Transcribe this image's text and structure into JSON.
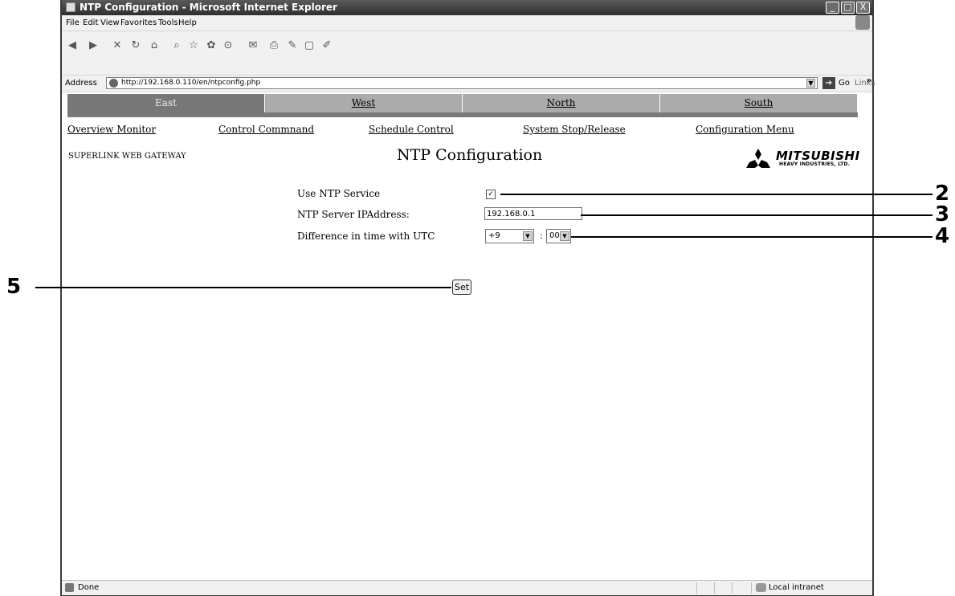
{
  "window": {
    "title": "NTP Configuration - Microsoft Internet Explorer",
    "minimize_label": "_",
    "maximize_label": "□",
    "close_label": "X"
  },
  "menu": [
    "File",
    "Edit",
    "View",
    "Favorites",
    "Tools",
    "Help"
  ],
  "toolbar": {
    "icons": [
      "back-icon",
      "forward-icon",
      "stop-icon",
      "refresh-icon",
      "home-icon",
      "search-icon",
      "favorites-icon",
      "media-icon",
      "history-icon",
      "mail-icon",
      "print-icon",
      "edit-icon",
      "discuss-icon",
      "research-icon"
    ],
    "glyphs": [
      "◀",
      "▶",
      "✕",
      "↻",
      "⌂",
      "⌕",
      "☆",
      "✿",
      "⊙",
      "✉",
      "⎙",
      "✎",
      "▢",
      "✐"
    ]
  },
  "address": {
    "label": "Address",
    "url": "http://192.168.0.110/en/ntpconfig.php",
    "go_label": "Go",
    "links_label": "Links",
    "links_chevron": "»"
  },
  "tabs": [
    "East",
    "West",
    "North",
    "South"
  ],
  "nav_links": [
    "Overview Monitor",
    "Control Commnand",
    "Schedule Control",
    "System Stop/Release",
    "Configuration Menu"
  ],
  "header": {
    "gateway": "SUPERLINK WEB GATEWAY",
    "page_title": "NTP Configuration",
    "logo_name": "MITSUBISHI",
    "logo_sub": "HEAVY INDUSTRIES, LTD."
  },
  "form": {
    "use_ntp_label": "Use NTP Service",
    "use_ntp_checked": true,
    "check_glyph": "✓",
    "server_ip_label": "NTP Server IPAddress:",
    "server_ip_value": "192.168.0.1",
    "utc_label": "Difference in time with UTC",
    "utc_hour": "+9",
    "utc_minute": "00",
    "colon": ":",
    "dropdown_glyph": "▼",
    "set_label": "Set"
  },
  "status": {
    "left": "Done",
    "zone": "Local intranet"
  },
  "callouts": [
    "2",
    "3",
    "4",
    "5"
  ]
}
